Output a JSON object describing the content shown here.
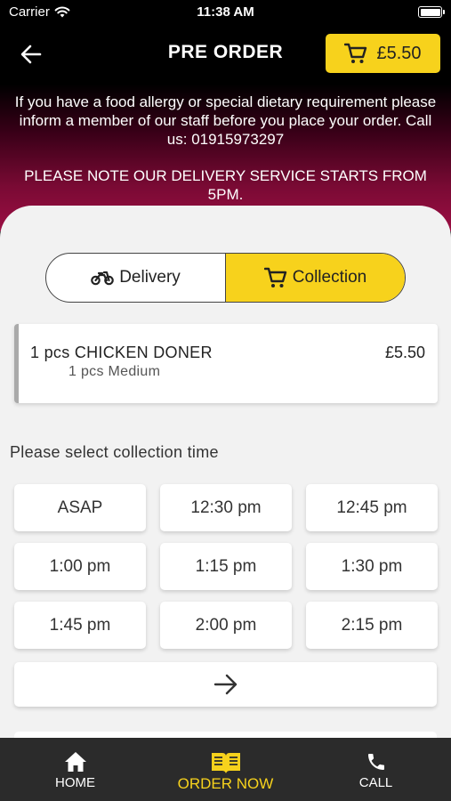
{
  "status_bar": {
    "carrier": "Carrier",
    "time": "11:38 AM"
  },
  "header": {
    "title": "PRE ORDER",
    "cart_total": "£5.50"
  },
  "notice": {
    "allergy": "If you have a food allergy or special dietary requirement please inform a member of our staff before you place your order. Call us: 01915973297",
    "delivery": "PLEASE NOTE OUR DELIVERY SERVICE STARTS FROM 5PM."
  },
  "order_type": {
    "delivery_label": "Delivery",
    "collection_label": "Collection",
    "selected": "Collection"
  },
  "order_item": {
    "name": "1 pcs CHICKEN DONER",
    "price": "£5.50",
    "modifier": "1 pcs Medium"
  },
  "collection": {
    "title": "Please select collection time",
    "times": [
      "ASAP",
      "12:30 pm",
      "12:45 pm",
      "1:00 pm",
      "1:15 pm",
      "1:30 pm",
      "1:45 pm",
      "2:00 pm",
      "2:15 pm"
    ]
  },
  "tabs": {
    "home": "HOME",
    "order_now": "ORDER NOW",
    "call": "CALL"
  },
  "colors": {
    "accent": "#f7d21c",
    "header_gradient_end": "#9b0e43",
    "tabbar": "#2b2b2b"
  }
}
